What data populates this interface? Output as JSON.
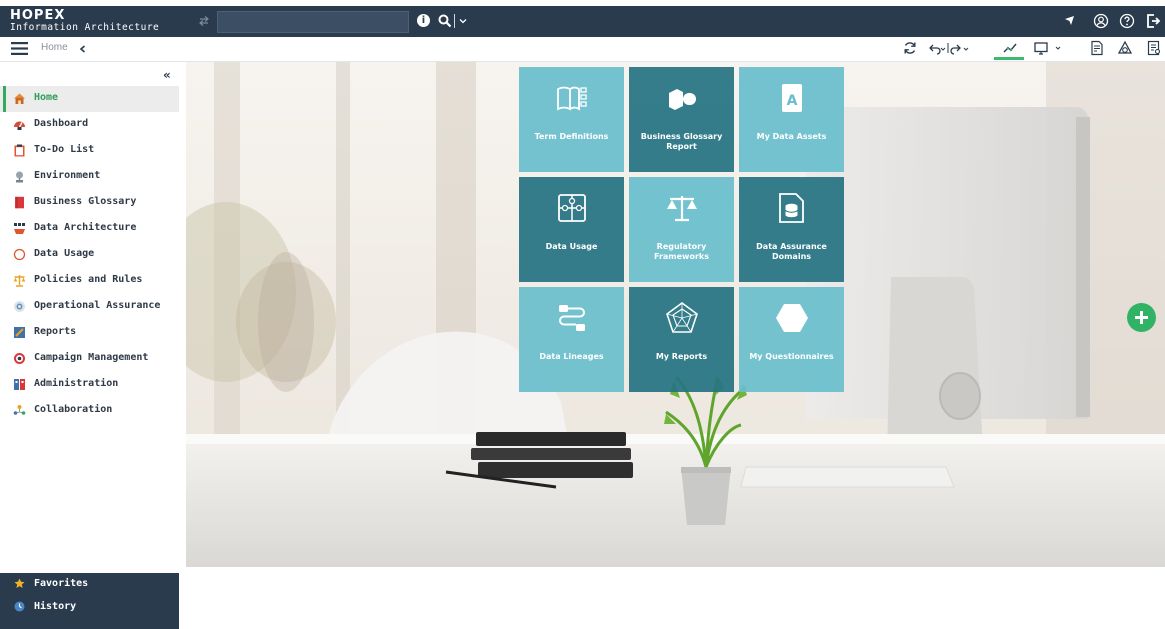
{
  "app": {
    "logo_line1": "HOPEX",
    "logo_line2": "Information Architecture"
  },
  "topbar": {
    "search_value": "",
    "info_icon": "info-icon",
    "right_icons": [
      "pointer-icon",
      "user-circle-icon",
      "help-icon",
      "logout-icon"
    ]
  },
  "breadcrumb": {
    "home_label": "Home"
  },
  "sidebar": {
    "collapse_label": "«",
    "items": [
      {
        "label": "Home",
        "icon": "home-icon",
        "active": true
      },
      {
        "label": "Dashboard",
        "icon": "dashboard-icon"
      },
      {
        "label": "To-Do List",
        "icon": "clipboard-icon"
      },
      {
        "label": "Environment",
        "icon": "environment-icon"
      },
      {
        "label": "Business Glossary",
        "icon": "book-icon"
      },
      {
        "label": "Data Architecture",
        "icon": "data-architecture-icon"
      },
      {
        "label": "Data Usage",
        "icon": "circle-icon"
      },
      {
        "label": "Policies and Rules",
        "icon": "scales-icon"
      },
      {
        "label": "Operational Assurance",
        "icon": "assurance-icon"
      },
      {
        "label": "Reports",
        "icon": "report-icon"
      },
      {
        "label": "Campaign Management",
        "icon": "target-icon"
      },
      {
        "label": "Administration",
        "icon": "administration-icon"
      },
      {
        "label": "Collaboration",
        "icon": "collaboration-icon"
      }
    ],
    "bottom": [
      {
        "label": "Favorites",
        "icon": "star-icon"
      },
      {
        "label": "History",
        "icon": "history-icon"
      }
    ]
  },
  "tiles": [
    {
      "label": "Term Definitions",
      "icon": "book-list-icon"
    },
    {
      "label": "Business Glossary Report",
      "icon": "glossary-report-icon"
    },
    {
      "label": "My Data Assets",
      "icon": "data-asset-icon"
    },
    {
      "label": "Data Usage",
      "icon": "puzzle-icon"
    },
    {
      "label": "Regulatory Frameworks",
      "icon": "scales-icon"
    },
    {
      "label": "Data Assurance Domains",
      "icon": "folder-database-icon"
    },
    {
      "label": "Data Lineages",
      "icon": "lineage-icon"
    },
    {
      "label": "My Reports",
      "icon": "radar-chart-icon"
    },
    {
      "label": "My Questionnaires",
      "icon": "hexagon-icon"
    }
  ],
  "colors": {
    "topbar": "#2b3b4e",
    "accent_green": "#35a95f",
    "tile_light": "#68becc",
    "tile_dark": "#267382"
  }
}
